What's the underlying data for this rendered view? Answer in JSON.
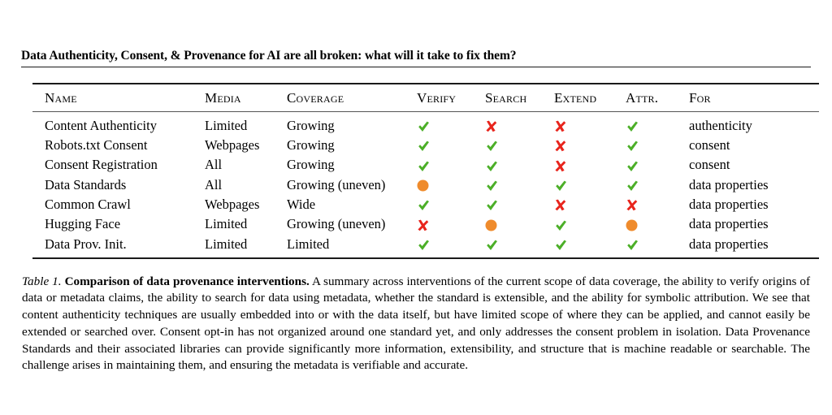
{
  "running_title": "Data Authenticity, Consent, & Provenance for AI are all broken: what will it take to fix them?",
  "table": {
    "columns": [
      {
        "key": "name",
        "label": "Name"
      },
      {
        "key": "media",
        "label": "Media"
      },
      {
        "key": "coverage",
        "label": "Coverage"
      },
      {
        "key": "verify",
        "label": "Verify"
      },
      {
        "key": "search",
        "label": "Search"
      },
      {
        "key": "extend",
        "label": "Extend"
      },
      {
        "key": "attr",
        "label": "Attr."
      },
      {
        "key": "for",
        "label": "For"
      }
    ],
    "rows": [
      {
        "name": "Content Authenticity",
        "media": "Limited",
        "coverage": "Growing",
        "verify": "check",
        "search": "cross",
        "extend": "cross",
        "attr": "check",
        "for": "authenticity"
      },
      {
        "name": "Robots.txt Consent",
        "media": "Webpages",
        "coverage": "Growing",
        "verify": "check",
        "search": "check",
        "extend": "cross",
        "attr": "check",
        "for": "consent"
      },
      {
        "name": "Consent Registration",
        "media": "All",
        "coverage": "Growing",
        "verify": "check",
        "search": "check",
        "extend": "cross",
        "attr": "check",
        "for": "consent"
      },
      {
        "name": "Data Standards",
        "media": "All",
        "coverage": "Growing (uneven)",
        "verify": "partial",
        "search": "check",
        "extend": "check",
        "attr": "check",
        "for": "data properties"
      },
      {
        "name": "Common Crawl",
        "media": "Webpages",
        "coverage": "Wide",
        "verify": "check",
        "search": "check",
        "extend": "cross",
        "attr": "cross",
        "for": "data properties"
      },
      {
        "name": "Hugging Face",
        "media": "Limited",
        "coverage": "Growing (uneven)",
        "verify": "cross",
        "search": "partial",
        "extend": "check",
        "attr": "partial",
        "for": "data properties"
      },
      {
        "name": "Data Prov. Init.",
        "media": "Limited",
        "coverage": "Limited",
        "verify": "check",
        "search": "check",
        "extend": "check",
        "attr": "check",
        "for": "data properties"
      }
    ],
    "symbol_legend": {
      "check": "green-check-icon",
      "cross": "red-cross-icon",
      "partial": "orange-circle-icon"
    },
    "symbol_colors": {
      "check": "#4CAF28",
      "cross": "#E8241C",
      "partial": "#EF8B2C"
    }
  },
  "caption": {
    "label": "Table 1",
    "label_suffix": ".",
    "bold_title": "Comparison of data provenance interventions.",
    "body": "A summary across interventions of the current scope of data coverage, the ability to verify origins of data or metadata claims, the ability to search for data using metadata, whether the standard is extensible, and the ability for symbolic attribution. We see that content authenticity techniques are usually embedded into or with the data itself, but have limited scope of where they can be applied, and cannot easily be extended or searched over. Consent opt-in has not organized around one standard yet, and only addresses the consent problem in isolation. Data Provenance Standards and their associated libraries can provide significantly more information, extensibility, and structure that is machine readable or searchable. The challenge arises in maintaining them, and ensuring the metadata is verifiable and accurate."
  }
}
